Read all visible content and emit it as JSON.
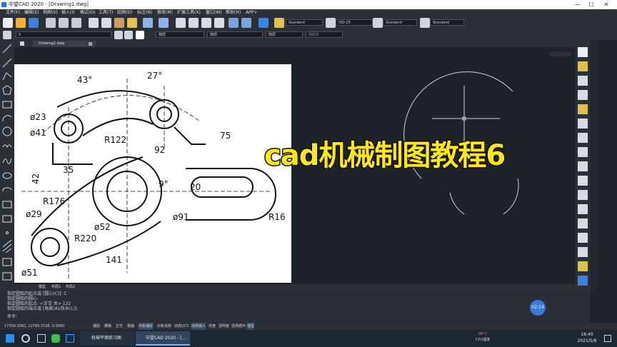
{
  "window": {
    "title": "中望CAD 2020 - [Drawing1.dwg]",
    "min": "—",
    "max": "☐",
    "close": "✕"
  },
  "menu": [
    "文件(F)",
    "编辑(E)",
    "视图(V)",
    "插入(I)",
    "格式(O)",
    "工具(T)",
    "绘图(D)",
    "标注(N)",
    "修改(M)",
    "扩展工具(X)",
    "窗口(W)",
    "帮助(H)",
    "APP+"
  ],
  "toolbar": {
    "text_style": "Standard",
    "dim_style": "ISO-25",
    "table_style": "Standard",
    "mleader_style": "Standard",
    "layer_value": "0",
    "color_value": "随层",
    "linetype_value": "随层",
    "lineweight_value": "随层",
    "plot_style": "随颜色"
  },
  "document_tab": "Drawing1.dwg",
  "drawing": {
    "dims": [
      "43°",
      "27°",
      "ø23",
      "ø41",
      "R122",
      "92",
      "75",
      "35",
      "42",
      "9°",
      "20",
      "R176",
      "ø29",
      "ø52",
      "ø91",
      "R16",
      "R220",
      "141",
      "ø51"
    ]
  },
  "overlay_title": "cad机械制图教程6",
  "command_tabs": [
    "模型",
    "布局1",
    "布局2"
  ],
  "command_lines": [
    "指定圆弧的起点或 [圆心(C)]: C",
    "指定圆弧的圆心:",
    "指定圆弧的起点: <正交 关> 122",
    "指定圆弧的端点或 [角度(A)/弦长(L)]:",
    "命令:"
  ],
  "timer_badge": "02:14",
  "status": {
    "coords": "17356.3362, 12765.3726, 0.0000",
    "toggles": [
      "捕捉",
      "栅格",
      "正交",
      "极轴",
      "对象捕捉",
      "对象追踪",
      "动态UCS",
      "动态输入",
      "线宽",
      "透明度",
      "选择循环",
      "模型"
    ]
  },
  "taskbar": {
    "apps": [
      "机械平面练习图",
      "中望CAD 2020 - [..."
    ],
    "temp": "98°C",
    "temp_label": "CPU温度",
    "time": "18:40",
    "date": "2021/5/8"
  },
  "colors": {
    "accent": "#ffe81a",
    "canvas": "#1e2229",
    "ui": "#2b2f37"
  }
}
